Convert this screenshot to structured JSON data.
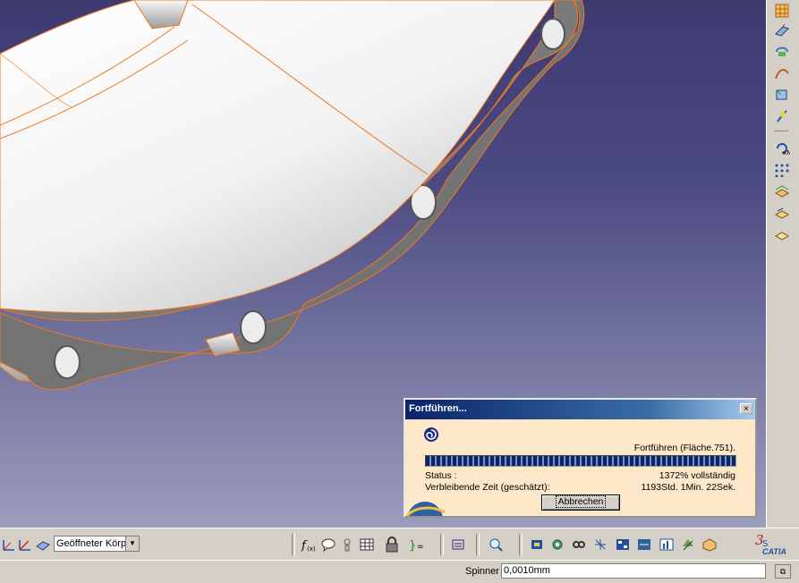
{
  "viewport": {
    "background_top": "#3d3a70",
    "background_bottom": "#9c9cbc",
    "edge_color": "#f07820"
  },
  "right_toolbar": {
    "icons": [
      "sketch-grid-icon",
      "extrude-icon",
      "revolve-icon",
      "sweep-icon",
      "boundary-icon",
      "pin-icon",
      "rotate-icon",
      "pattern-icon",
      "surface-stack-icon",
      "layer-icon",
      "layer-small-icon"
    ]
  },
  "bottom_toolbar": {
    "left_icons": [
      "axis-icon",
      "plane-icon"
    ],
    "body_select": {
      "value": "Geöffneter Körp"
    },
    "icons": [
      "formula-icon",
      "comment-icon",
      "knowledge-icon",
      "table-icon",
      "lock-icon",
      "bracket-icon",
      "publish-icon",
      "measure-icon",
      "part-icon",
      "gear-icon",
      "link-icon",
      "axis-star-icon",
      "grid-view-icon",
      "compare-icon",
      "chart-icon",
      "tree-icon",
      "box-icon"
    ],
    "brand": "CATIA"
  },
  "status_bar": {
    "label": "Spinner",
    "value": "0,0010mm"
  },
  "dialog": {
    "title": "Fortführen...",
    "close": "×",
    "operation": "Fortführen (Fläche.751).",
    "progress": 1.0,
    "status_label": "Status :",
    "status_value": "1372% vollständig",
    "time_label": "Verbleibende Zeit (geschätzt):",
    "time_value": "1193Std. 1Min. 22Sek.",
    "abort": "Abbrechen"
  }
}
